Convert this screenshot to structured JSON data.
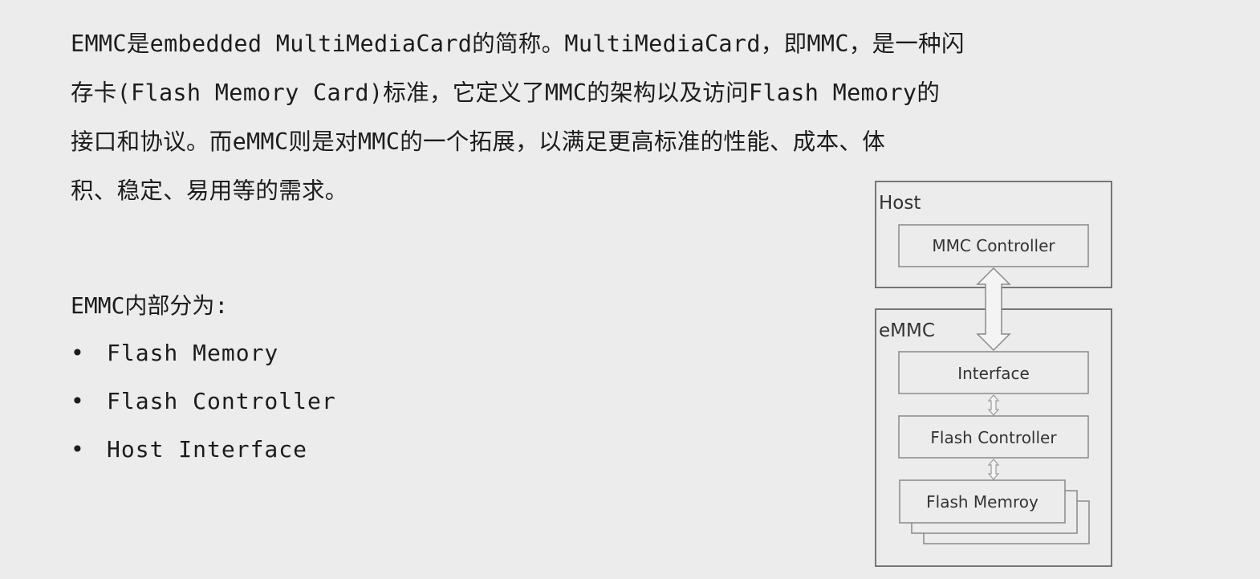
{
  "intro": {
    "line1": "EMMC是embedded MultiMediaCard的简称。MultiMediaCard，即MMC，是一种闪",
    "line2": "存卡(Flash Memory Card)标准，它定义了MMC的架构以及访问Flash Memory的",
    "line3": "接口和协议。而eMMC则是对MMC的一个拓展，以满足更高标准的性能、成本、体",
    "line4": "积、稳定、易用等的需求。"
  },
  "section": {
    "title": "EMMC内部分为:",
    "bullet_symbol": "•",
    "items": [
      "Flash Memory",
      "Flash Controller",
      "Host Interface"
    ]
  },
  "diagram": {
    "host_label": "Host",
    "mmc_controller": "MMC Controller",
    "emmc_label": "eMMC",
    "interface": "Interface",
    "flash_controller": "Flash Controller",
    "flash_memory": "Flash Memroy"
  }
}
